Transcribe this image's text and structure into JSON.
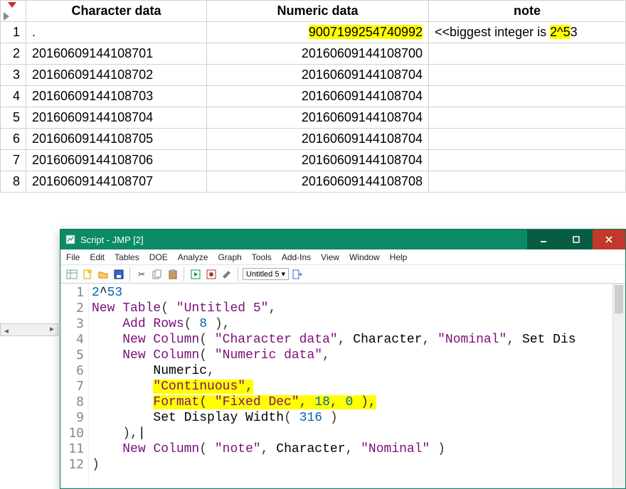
{
  "table": {
    "columns": [
      "Character data",
      "Numeric data",
      "note"
    ],
    "rows": [
      {
        "n": "1",
        "char": ".",
        "num": "9007199254740992",
        "num_hl": true,
        "note_prefix": "<<biggest integer is ",
        "note_hl": "2^5",
        "note_suffix": "3"
      },
      {
        "n": "2",
        "char": "20160609144108701",
        "num": "20160609144108700"
      },
      {
        "n": "3",
        "char": "20160609144108702",
        "num": "20160609144108704"
      },
      {
        "n": "4",
        "char": "20160609144108703",
        "num": "20160609144108704"
      },
      {
        "n": "5",
        "char": "20160609144108704",
        "num": "20160609144108704"
      },
      {
        "n": "6",
        "char": "20160609144108705",
        "num": "20160609144108704"
      },
      {
        "n": "7",
        "char": "20160609144108706",
        "num": "20160609144108704"
      },
      {
        "n": "8",
        "char": "20160609144108707",
        "num": "20160609144108708"
      }
    ]
  },
  "scriptwin": {
    "title": "Script - JMP [2]",
    "menus": [
      "File",
      "Edit",
      "Tables",
      "DOE",
      "Analyze",
      "Graph",
      "Tools",
      "Add-Ins",
      "View",
      "Window",
      "Help"
    ],
    "tabselect": "Untitled 5",
    "code_lines": [
      {
        "n": "1",
        "segs": [
          {
            "t": "2",
            "c": "num"
          },
          {
            "t": "^",
            "c": "plain"
          },
          {
            "t": "53",
            "c": "num"
          }
        ]
      },
      {
        "n": "2",
        "segs": [
          {
            "t": "New Table",
            "c": "name"
          },
          {
            "t": "( ",
            "c": "paren"
          },
          {
            "t": "\"Untitled 5\"",
            "c": "str"
          },
          {
            "t": ",",
            "c": "paren"
          }
        ]
      },
      {
        "n": "3",
        "segs": [
          {
            "t": "    ",
            "c": "plain"
          },
          {
            "t": "Add Rows",
            "c": "name"
          },
          {
            "t": "( ",
            "c": "paren"
          },
          {
            "t": "8",
            "c": "num"
          },
          {
            "t": " ),",
            "c": "paren"
          }
        ]
      },
      {
        "n": "4",
        "segs": [
          {
            "t": "    ",
            "c": "plain"
          },
          {
            "t": "New Column",
            "c": "name"
          },
          {
            "t": "( ",
            "c": "paren"
          },
          {
            "t": "\"Character data\"",
            "c": "str"
          },
          {
            "t": ", ",
            "c": "paren"
          },
          {
            "t": "Character",
            "c": "func"
          },
          {
            "t": ", ",
            "c": "paren"
          },
          {
            "t": "\"Nominal\"",
            "c": "str"
          },
          {
            "t": ", ",
            "c": "paren"
          },
          {
            "t": "Set Dis",
            "c": "func"
          }
        ]
      },
      {
        "n": "5",
        "segs": [
          {
            "t": "    ",
            "c": "plain"
          },
          {
            "t": "New Column",
            "c": "name"
          },
          {
            "t": "( ",
            "c": "paren"
          },
          {
            "t": "\"Numeric data\"",
            "c": "str"
          },
          {
            "t": ",",
            "c": "paren"
          }
        ]
      },
      {
        "n": "6",
        "segs": [
          {
            "t": "        ",
            "c": "plain"
          },
          {
            "t": "Numeric",
            "c": "func"
          },
          {
            "t": ",",
            "c": "paren"
          }
        ]
      },
      {
        "n": "7",
        "segs": [
          {
            "t": "        ",
            "c": "plain"
          },
          {
            "t": "\"Continuous\"",
            "c": "str",
            "hl": true
          },
          {
            "t": ",",
            "c": "paren",
            "hl": true
          }
        ]
      },
      {
        "n": "8",
        "segs": [
          {
            "t": "        ",
            "c": "plain"
          },
          {
            "t": "Format",
            "c": "name",
            "hl": true
          },
          {
            "t": "( ",
            "c": "paren",
            "hl": true
          },
          {
            "t": "\"Fixed Dec\"",
            "c": "str",
            "hl": true
          },
          {
            "t": ", ",
            "c": "paren",
            "hl": true
          },
          {
            "t": "18",
            "c": "num",
            "hl": true
          },
          {
            "t": ", ",
            "c": "paren",
            "hl": true
          },
          {
            "t": "0",
            "c": "num",
            "hl": true
          },
          {
            "t": " ),",
            "c": "paren",
            "hl": true
          }
        ]
      },
      {
        "n": "9",
        "segs": [
          {
            "t": "        ",
            "c": "plain"
          },
          {
            "t": "Set Display Width",
            "c": "func"
          },
          {
            "t": "( ",
            "c": "paren"
          },
          {
            "t": "316",
            "c": "num"
          },
          {
            "t": " )",
            "c": "paren"
          }
        ]
      },
      {
        "n": "10",
        "segs": [
          {
            "t": "    ),",
            "c": "paren"
          },
          {
            "t": "|",
            "c": "plain"
          }
        ]
      },
      {
        "n": "11",
        "segs": [
          {
            "t": "    ",
            "c": "plain"
          },
          {
            "t": "New Column",
            "c": "name"
          },
          {
            "t": "( ",
            "c": "paren"
          },
          {
            "t": "\"note\"",
            "c": "str"
          },
          {
            "t": ", ",
            "c": "paren"
          },
          {
            "t": "Character",
            "c": "func"
          },
          {
            "t": ", ",
            "c": "paren"
          },
          {
            "t": "\"Nominal\"",
            "c": "str"
          },
          {
            "t": " )",
            "c": "paren"
          }
        ]
      },
      {
        "n": "12",
        "segs": [
          {
            "t": ")",
            "c": "paren"
          }
        ]
      }
    ]
  }
}
